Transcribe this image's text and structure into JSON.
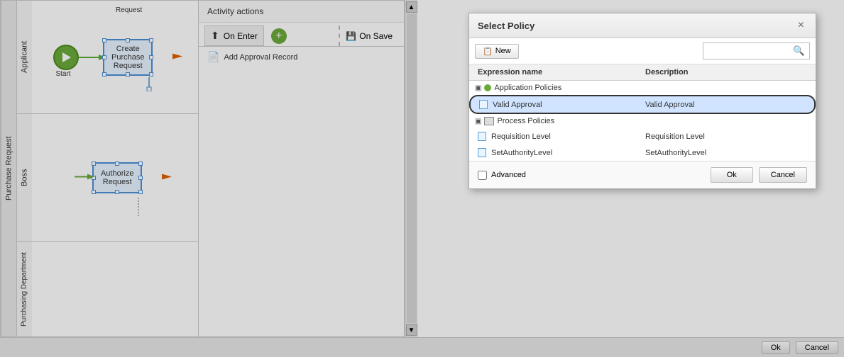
{
  "modal": {
    "title": "Select Policy",
    "close_label": "×",
    "toolbar": {
      "new_button": "New",
      "new_icon": "📋",
      "search_placeholder": ""
    },
    "table": {
      "col1_header": "Expression name",
      "col2_header": "Description",
      "groups": [
        {
          "name": "Application Policies",
          "rows": [
            {
              "name": "Valid Approval",
              "description": "Valid Approval",
              "selected": true
            }
          ]
        },
        {
          "name": "Process Policies",
          "rows": [
            {
              "name": "Requisition Level",
              "description": "Requisition Level",
              "selected": false
            },
            {
              "name": "SetAuthorityLevel",
              "description": "SetAuthorityLevel",
              "selected": false
            }
          ]
        }
      ]
    },
    "footer": {
      "advanced_label": "Advanced",
      "ok_label": "Ok",
      "cancel_label": "Cancel"
    }
  },
  "activity_panel": {
    "title": "Activity actions",
    "on_enter_label": "On Enter",
    "on_save_label": "On Save",
    "add_approval_label": "Add Approval Record"
  },
  "workflow": {
    "process_label": "Purchase Request",
    "lanes": [
      {
        "id": "applicant",
        "label": "Applicant"
      },
      {
        "id": "boss",
        "label": "Boss"
      },
      {
        "id": "purchasing",
        "label": "Purchasing Department"
      }
    ],
    "nodes": [
      {
        "id": "start",
        "label": "Start",
        "type": "start",
        "lane": "applicant"
      },
      {
        "id": "create-purchase-request",
        "label": "Create\nPurchase\nRequest",
        "type": "task",
        "lane": "applicant"
      },
      {
        "id": "authorize-request",
        "label": "Authorize\nRequest",
        "type": "task",
        "lane": "boss"
      }
    ],
    "request_label": "Request"
  },
  "bottom_bar": {
    "ok_label": "Ok",
    "cancel_label": "Cancel"
  }
}
